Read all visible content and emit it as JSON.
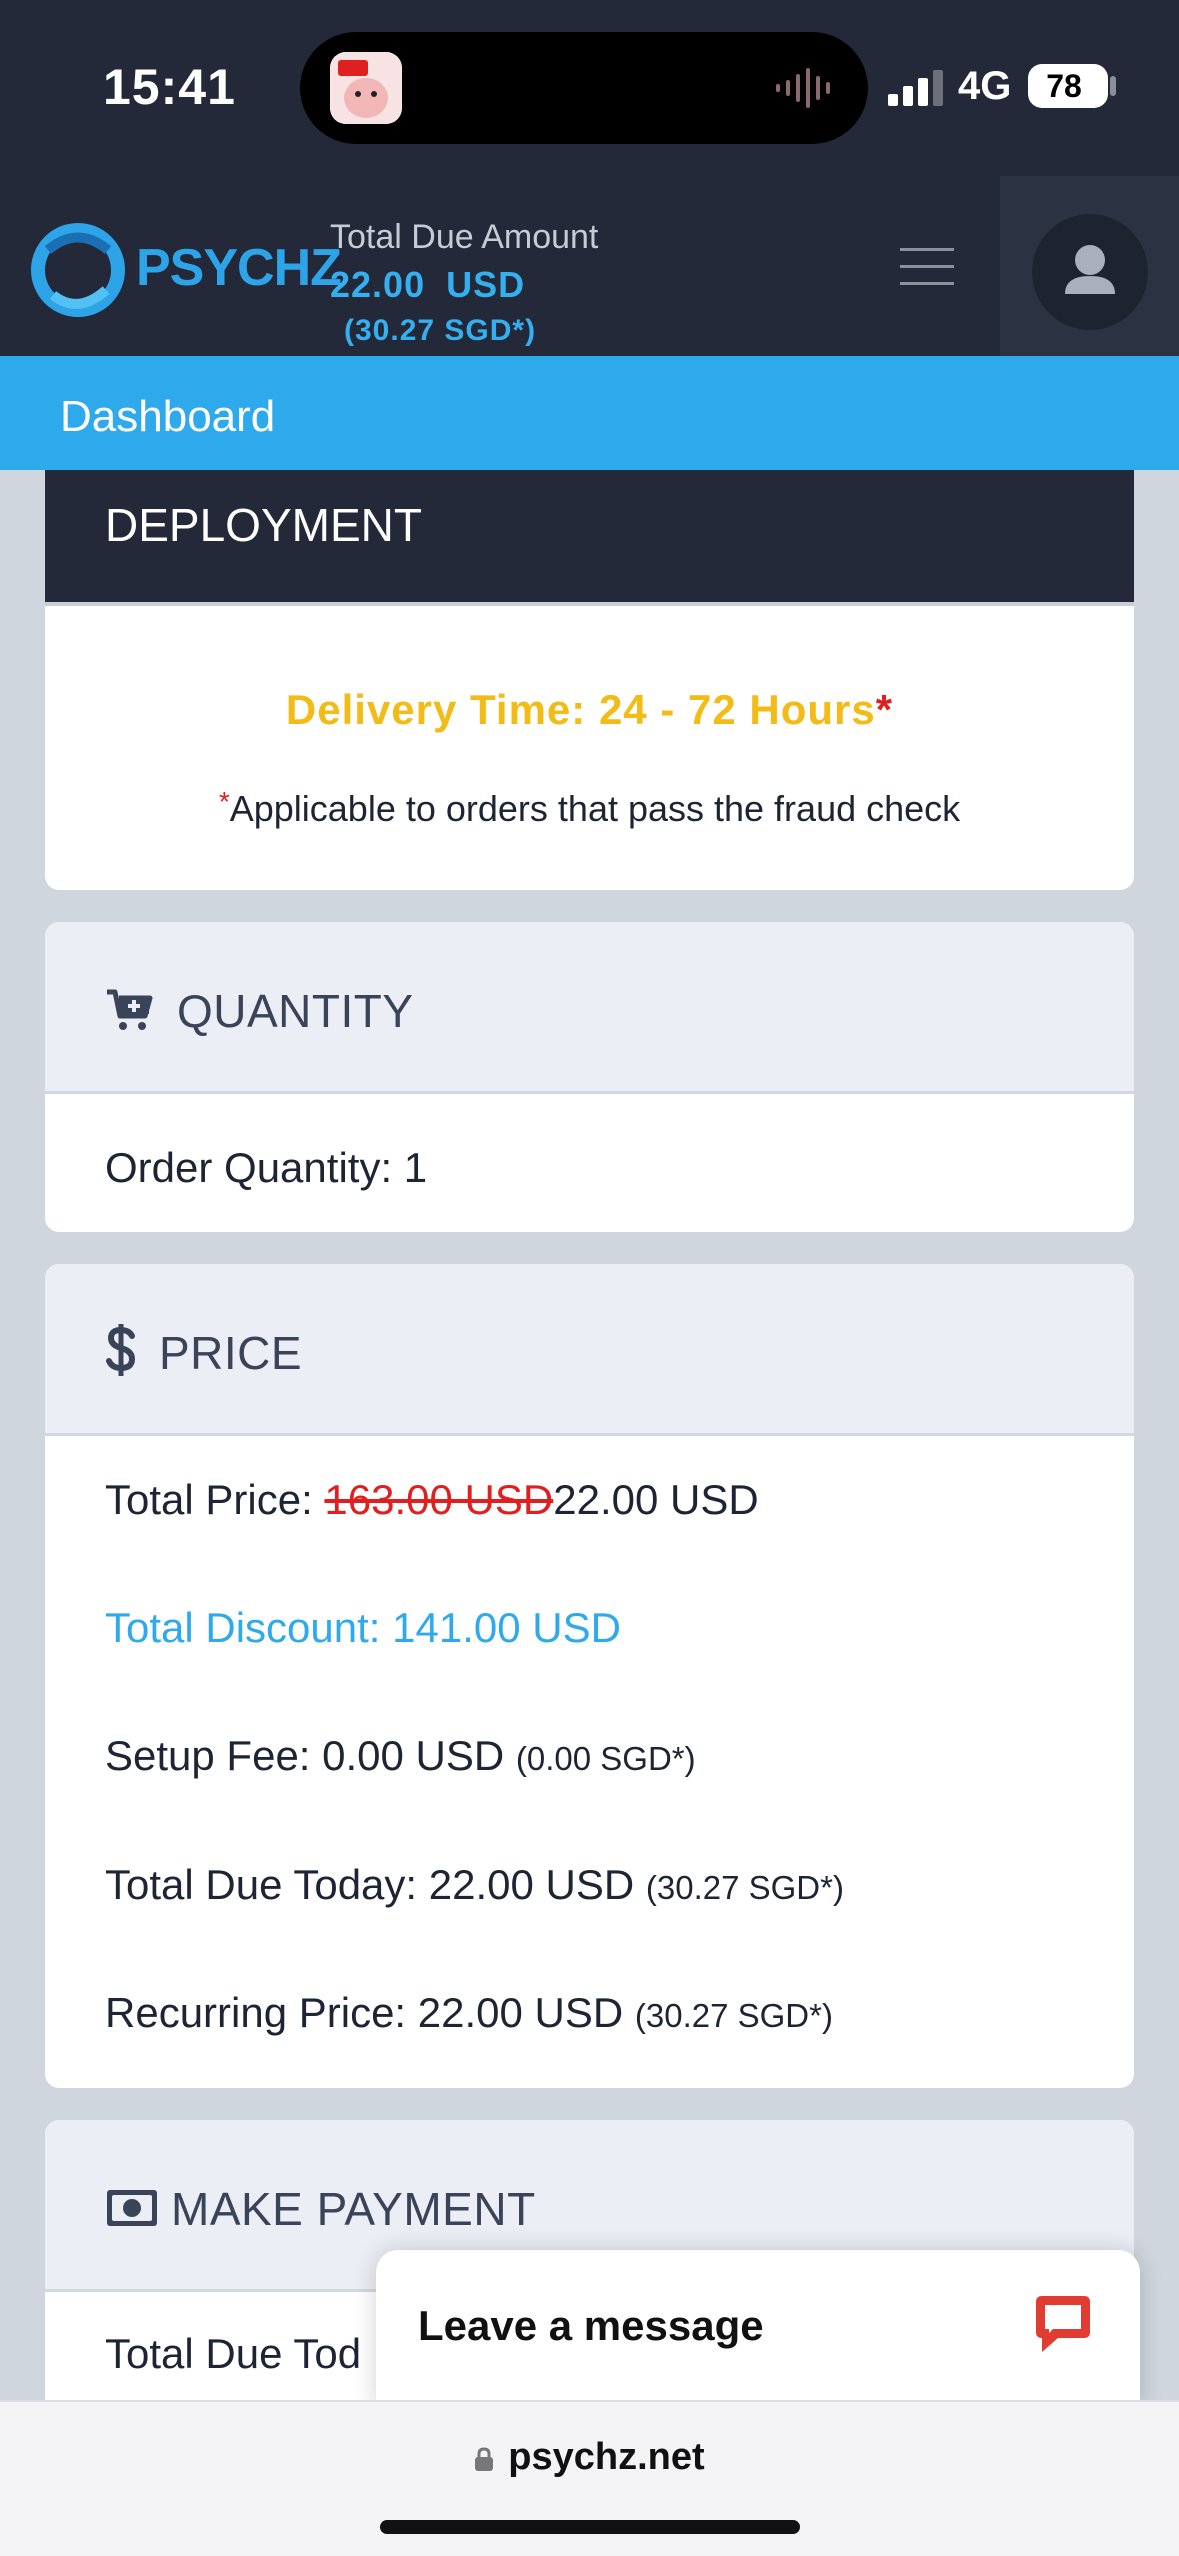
{
  "status_bar": {
    "time": "15:41",
    "network": "4G",
    "battery": "78"
  },
  "header": {
    "brand": "PSYCHZ",
    "due_label": "Total Due Amount",
    "due_amount": "22.00  USD",
    "due_sgd": "(30.27 SGD*)"
  },
  "nav": {
    "section": "Dashboard"
  },
  "deployment": {
    "title": "DEPLOYMENT",
    "delivery_text": "Delivery Time: 24 - 72 Hours",
    "delivery_star": "*",
    "note_star": "*",
    "note_text": "Applicable to orders that pass the fraud check"
  },
  "quantity": {
    "title": "QUANTITY",
    "order_quantity": "Order Quantity: 1"
  },
  "price": {
    "title": "PRICE",
    "total_price_label": "Total Price: ",
    "original_price": "163.00 USD",
    "current_price": "22.00 USD",
    "total_discount": "Total Discount: 141.00 USD",
    "setup_fee": "Setup Fee: 0.00 USD",
    "setup_fee_sgd": "(0.00 SGD*)",
    "total_due_today": "Total Due Today: 22.00 USD",
    "total_due_today_sgd": "(30.27 SGD*)",
    "recurring_price": "Recurring Price: 22.00 USD",
    "recurring_price_sgd": "(30.27 SGD*)"
  },
  "payment": {
    "title": "MAKE PAYMENT",
    "row_partial": "Total Due Tod"
  },
  "chat": {
    "label": "Leave a message"
  },
  "browser": {
    "url": "psychz.net"
  },
  "colors": {
    "accent": "#2ea9ec",
    "header_bg": "#232938",
    "delivery": "#f3bb16",
    "strike": "#e02020",
    "chat_icon": "#e03c31"
  },
  "icons": {
    "cart": "cart-plus-icon",
    "price": "dollar-icon",
    "payment": "money-bill-icon",
    "chat": "chat-bubble-icon",
    "user": "user-icon",
    "menu": "hamburger-icon",
    "lock": "lock-icon"
  }
}
